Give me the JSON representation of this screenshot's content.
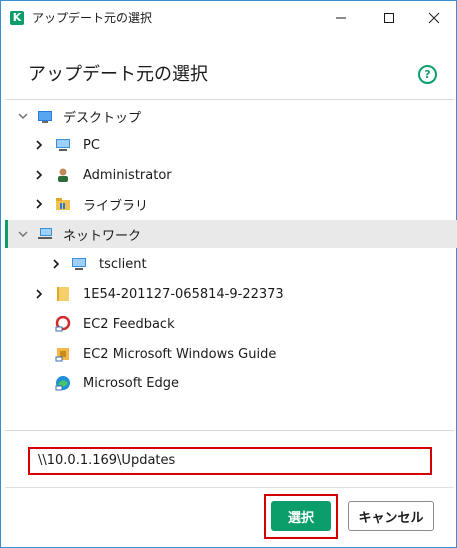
{
  "window": {
    "title": "アップデート元の選択",
    "logo_letter": "K"
  },
  "header": {
    "title": "アップデート元の選択",
    "help_glyph": "?"
  },
  "tree": {
    "items": [
      {
        "label": "デスクトップ",
        "icon": "desktop-icon",
        "expander": "expanded"
      },
      {
        "label": "PC",
        "icon": "computer-icon",
        "expander": "collapsed"
      },
      {
        "label": "Administrator",
        "icon": "user-icon",
        "expander": "collapsed"
      },
      {
        "label": "ライブラリ",
        "icon": "library-folder-icon",
        "expander": "collapsed"
      },
      {
        "label": "ネットワーク",
        "icon": "network-icon",
        "expander": "expanded",
        "selected": true
      },
      {
        "label": "tsclient",
        "icon": "monitor-icon",
        "expander": "collapsed"
      },
      {
        "label": "1E54-201127-065814-9-22373",
        "icon": "folder-icon",
        "expander": "collapsed"
      },
      {
        "label": "EC2 Feedback",
        "icon": "feedback-shortcut-icon",
        "expander": "none"
      },
      {
        "label": "EC2 Microsoft Windows Guide",
        "icon": "guide-shortcut-icon",
        "expander": "none"
      },
      {
        "label": "Microsoft Edge",
        "icon": "edge-icon",
        "expander": "none"
      }
    ]
  },
  "path_input": {
    "value": "\\\\10.0.1.169\\Updates"
  },
  "buttons": {
    "ok_label": "選択",
    "cancel_label": "キャンセル"
  },
  "colors": {
    "accent": "#0b9e6b",
    "highlight_outline": "#d40000",
    "selected_row_bg": "#e9e9e9"
  }
}
